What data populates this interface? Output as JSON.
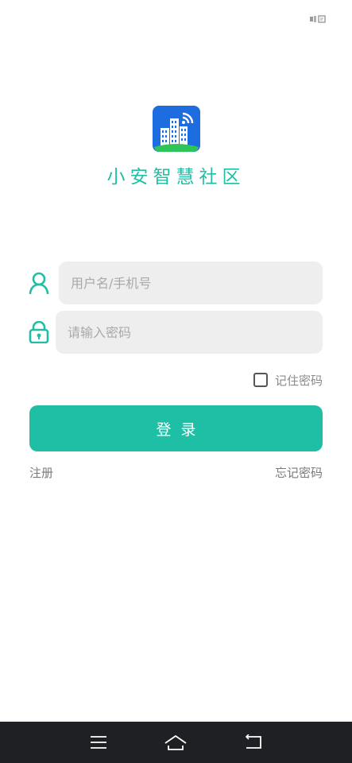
{
  "app": {
    "name": "小安智慧社区",
    "accent_color": "#1fbfa6"
  },
  "login_form": {
    "username": {
      "placeholder": "用户名/手机号",
      "value": "",
      "icon": "user-icon"
    },
    "password": {
      "placeholder": "请输入密码",
      "value": "",
      "icon": "lock-icon"
    },
    "remember_label": "记住密码",
    "remember_checked": false,
    "submit_label": "登录"
  },
  "links": {
    "register": "注册",
    "forgot_password": "忘记密码"
  },
  "status_bar": {
    "icon": "notification-icon"
  },
  "nav_bar": {
    "items": [
      "menu-icon",
      "home-icon",
      "back-icon"
    ]
  }
}
